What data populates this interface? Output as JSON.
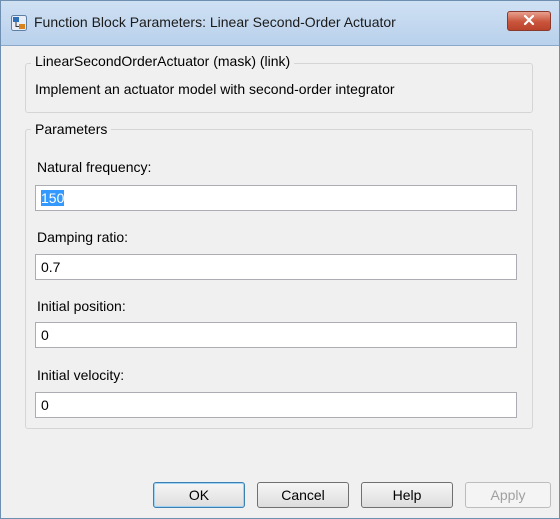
{
  "window": {
    "title": "Function Block Parameters: Linear Second-Order Actuator",
    "icons": {
      "app": "simulink-block-icon",
      "close": "close-icon"
    }
  },
  "mask": {
    "header": "LinearSecondOrderActuator (mask) (link)",
    "description": "Implement an actuator model with second-order integrator"
  },
  "parameters": {
    "legend": "Parameters",
    "natural_frequency": {
      "label": "Natural frequency:",
      "value": "150"
    },
    "damping_ratio": {
      "label": "Damping ratio:",
      "value": "0.7"
    },
    "initial_position": {
      "label": "Initial position:",
      "value": "0"
    },
    "initial_velocity": {
      "label": "Initial velocity:",
      "value": "0"
    }
  },
  "buttons": {
    "ok": "OK",
    "cancel": "Cancel",
    "help": "Help",
    "apply": "Apply"
  },
  "colors": {
    "selection": "#3399ff",
    "close_button": "#c9543b",
    "titlebar": "#cfe0f3"
  }
}
